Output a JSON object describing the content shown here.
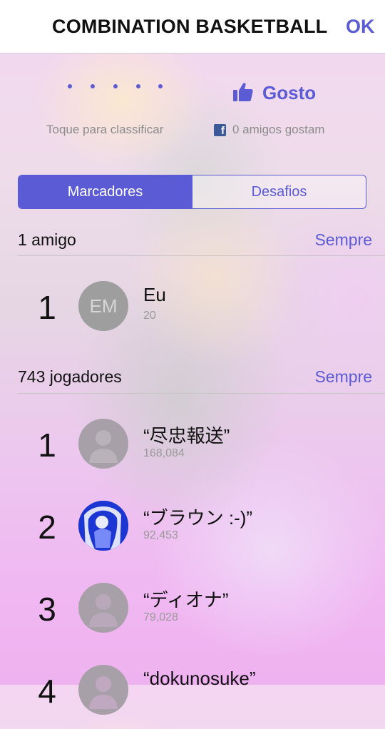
{
  "header": {
    "title": "COMBINATION BASKETBALL",
    "ok_label": "OK"
  },
  "rating": {
    "hint": "Toque para classificar",
    "stars_count": 5
  },
  "like": {
    "label": "Gosto",
    "friends_text": "0 amigos gostam",
    "icon": "thumbs-up-icon"
  },
  "tabs": [
    {
      "label": "Marcadores",
      "selected": true
    },
    {
      "label": "Desafios",
      "selected": false
    }
  ],
  "friends_section": {
    "title": "1 amigo",
    "filter": "Sempre",
    "rows": [
      {
        "rank": "1",
        "initials": "EM",
        "name": "Eu",
        "score": "20"
      }
    ]
  },
  "players_section": {
    "title": "743 jogadores",
    "filter": "Sempre",
    "rows": [
      {
        "rank": "1",
        "name": "“尽忠報送”",
        "score": "168,084",
        "avatar": "person-placeholder"
      },
      {
        "rank": "2",
        "name": "“ブラウン :-)”",
        "score": "92,453",
        "avatar": "user-photo"
      },
      {
        "rank": "3",
        "name": "“ディオナ”",
        "score": "79,028",
        "avatar": "person-placeholder"
      },
      {
        "rank": "4",
        "name": "“dokunosuke”",
        "score": "",
        "avatar": "person-placeholder"
      }
    ]
  },
  "colors": {
    "accent": "#5b5bd6",
    "header_bg": "#ffffff",
    "secondary_text": "#8c8c8c"
  }
}
